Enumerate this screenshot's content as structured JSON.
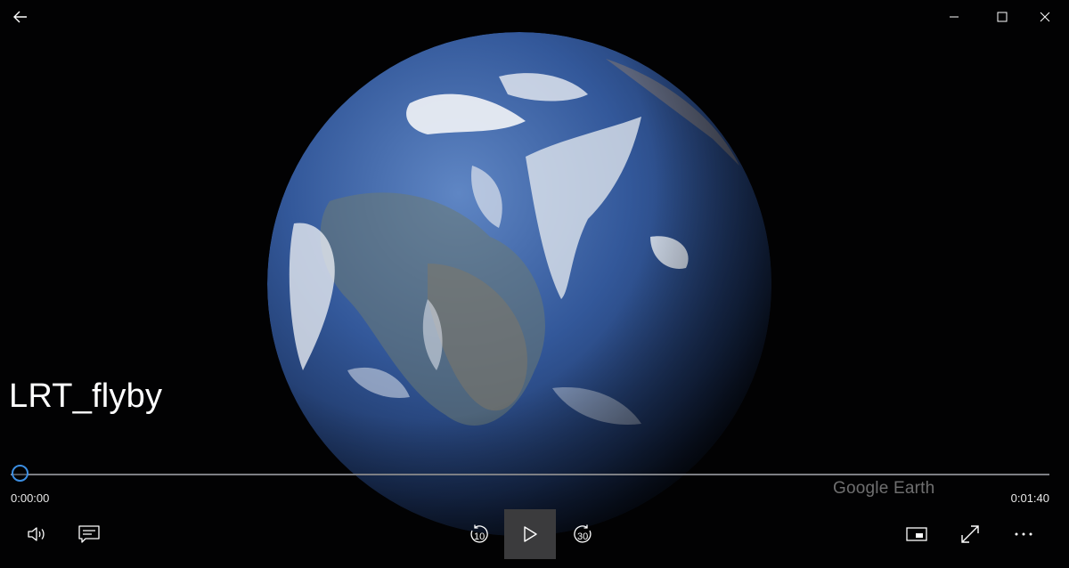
{
  "window": {
    "back_icon": "arrow-left-icon",
    "minimize_icon": "minimize-icon",
    "maximize_icon": "maximize-icon",
    "close_icon": "close-icon"
  },
  "video": {
    "title": "LRT_flyby",
    "watermark": "Google Earth"
  },
  "playback": {
    "current_time": "0:00:00",
    "total_time": "0:01:40",
    "progress": 0.0
  },
  "controls": {
    "volume_icon": "volume-icon",
    "captions_icon": "captions-icon",
    "skip_back": "10",
    "skip_forward": "30",
    "play_icon": "play-icon",
    "mini_view_icon": "mini-view-icon",
    "fullscreen_icon": "fullscreen-icon",
    "more_icon": "more-icon"
  },
  "colors": {
    "accent": "#3c8ee2",
    "background": "#000000"
  }
}
